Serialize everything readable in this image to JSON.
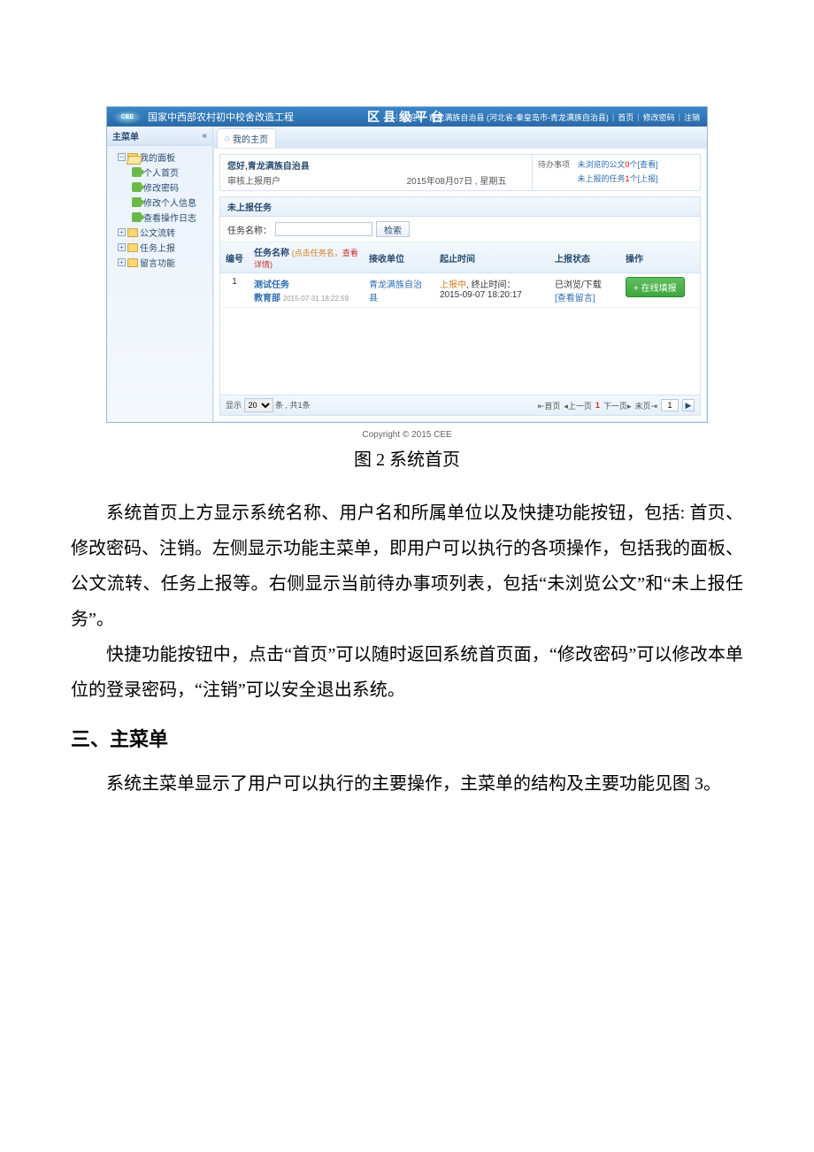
{
  "screenshot": {
    "banner": {
      "system_name": "国家中西部农村初中校舍改造工程",
      "platform_title": "区县级平台",
      "welcome_prefix": "欢迎：",
      "welcome_user": "青龙满族自治县 (河北省-秦皇岛市-青龙满族自治县)",
      "links": {
        "home": "首页",
        "changepw": "修改密码",
        "logout": "注销"
      }
    },
    "sidebar": {
      "title": "主菜单",
      "nodes": {
        "panel": "我的面板",
        "personal_home": "个人首页",
        "changepw": "修改密码",
        "edit_info": "修改个人信息",
        "view_log": "查看操作日志",
        "doc_flow": "公文流转",
        "task_report": "任务上报",
        "message": "留言功能"
      }
    },
    "tab": {
      "home_label": "我的主页"
    },
    "greeting": {
      "hello_prefix": "您好,",
      "user_name": "青龙满族自治县",
      "sub": "审核上报用户",
      "date": "2015年08月07日",
      "weekday": "星期五",
      "todo_label": "待办事项",
      "unread_doc_prefix": "未浏览的公文",
      "unread_doc_count": "0",
      "unread_doc_suffix": "个",
      "unread_doc_action": "[查看]",
      "unreported_task_prefix": "未上报的任务",
      "unreported_task_count": "1",
      "unreported_task_suffix": "个",
      "unreported_task_action": "[上报]"
    },
    "task": {
      "panel_title": "未上报任务",
      "search_label": "任务名称：",
      "search_placeholder": "",
      "search_btn": "检索",
      "headers": {
        "no": "编号",
        "name": "任务名称",
        "name_hint1": "(点击任务名，",
        "name_hint2": "查看详情)",
        "receiver": "接收单位",
        "deadline": "起止时间",
        "status": "上报状态",
        "action": "操作"
      },
      "rows": [
        {
          "no": "1",
          "name": "测试任务",
          "publisher": "教育部",
          "publish_time": "2015-07-31 18:22:59",
          "receiver": "青龙满族自治县",
          "status_prefix": "上报中",
          "deadline_label": "终止时间：",
          "deadline": "2015-09-07 18:20:17",
          "status_text": "已浏览/下载",
          "status_link": "[查看留言]",
          "action_btn": "+ 在线填报"
        }
      ],
      "pager": {
        "show_prefix": "显示",
        "page_size": "20",
        "show_mid": "条 , 共",
        "total": "1",
        "show_suffix": "条",
        "first": "首页",
        "prev": "上一页",
        "current": "1",
        "next": "下一页",
        "last": "末页",
        "goto_value": "1"
      }
    },
    "copyright": "Copyright © 2015 CEE"
  },
  "figure_caption": "图 2  系统首页",
  "paragraphs": {
    "p1": "系统首页上方显示系统名称、用户名和所属单位以及快捷功能按钮，包括: 首页、修改密码、注销。左侧显示功能主菜单，即用户可以执行的各项操作，包括我的面板、公文流转、任务上报等。右侧显示当前待办事项列表，包括“未浏览公文”和“未上报任务”。",
    "p2": "快捷功能按钮中，点击“首页”可以随时返回系统首页面，“修改密码”可以修改本单位的登录密码，“注销”可以安全退出系统。",
    "p3": "系统主菜单显示了用户可以执行的主要操作，主菜单的结构及主要功能见图 3。"
  },
  "heading3": "三、主菜单"
}
